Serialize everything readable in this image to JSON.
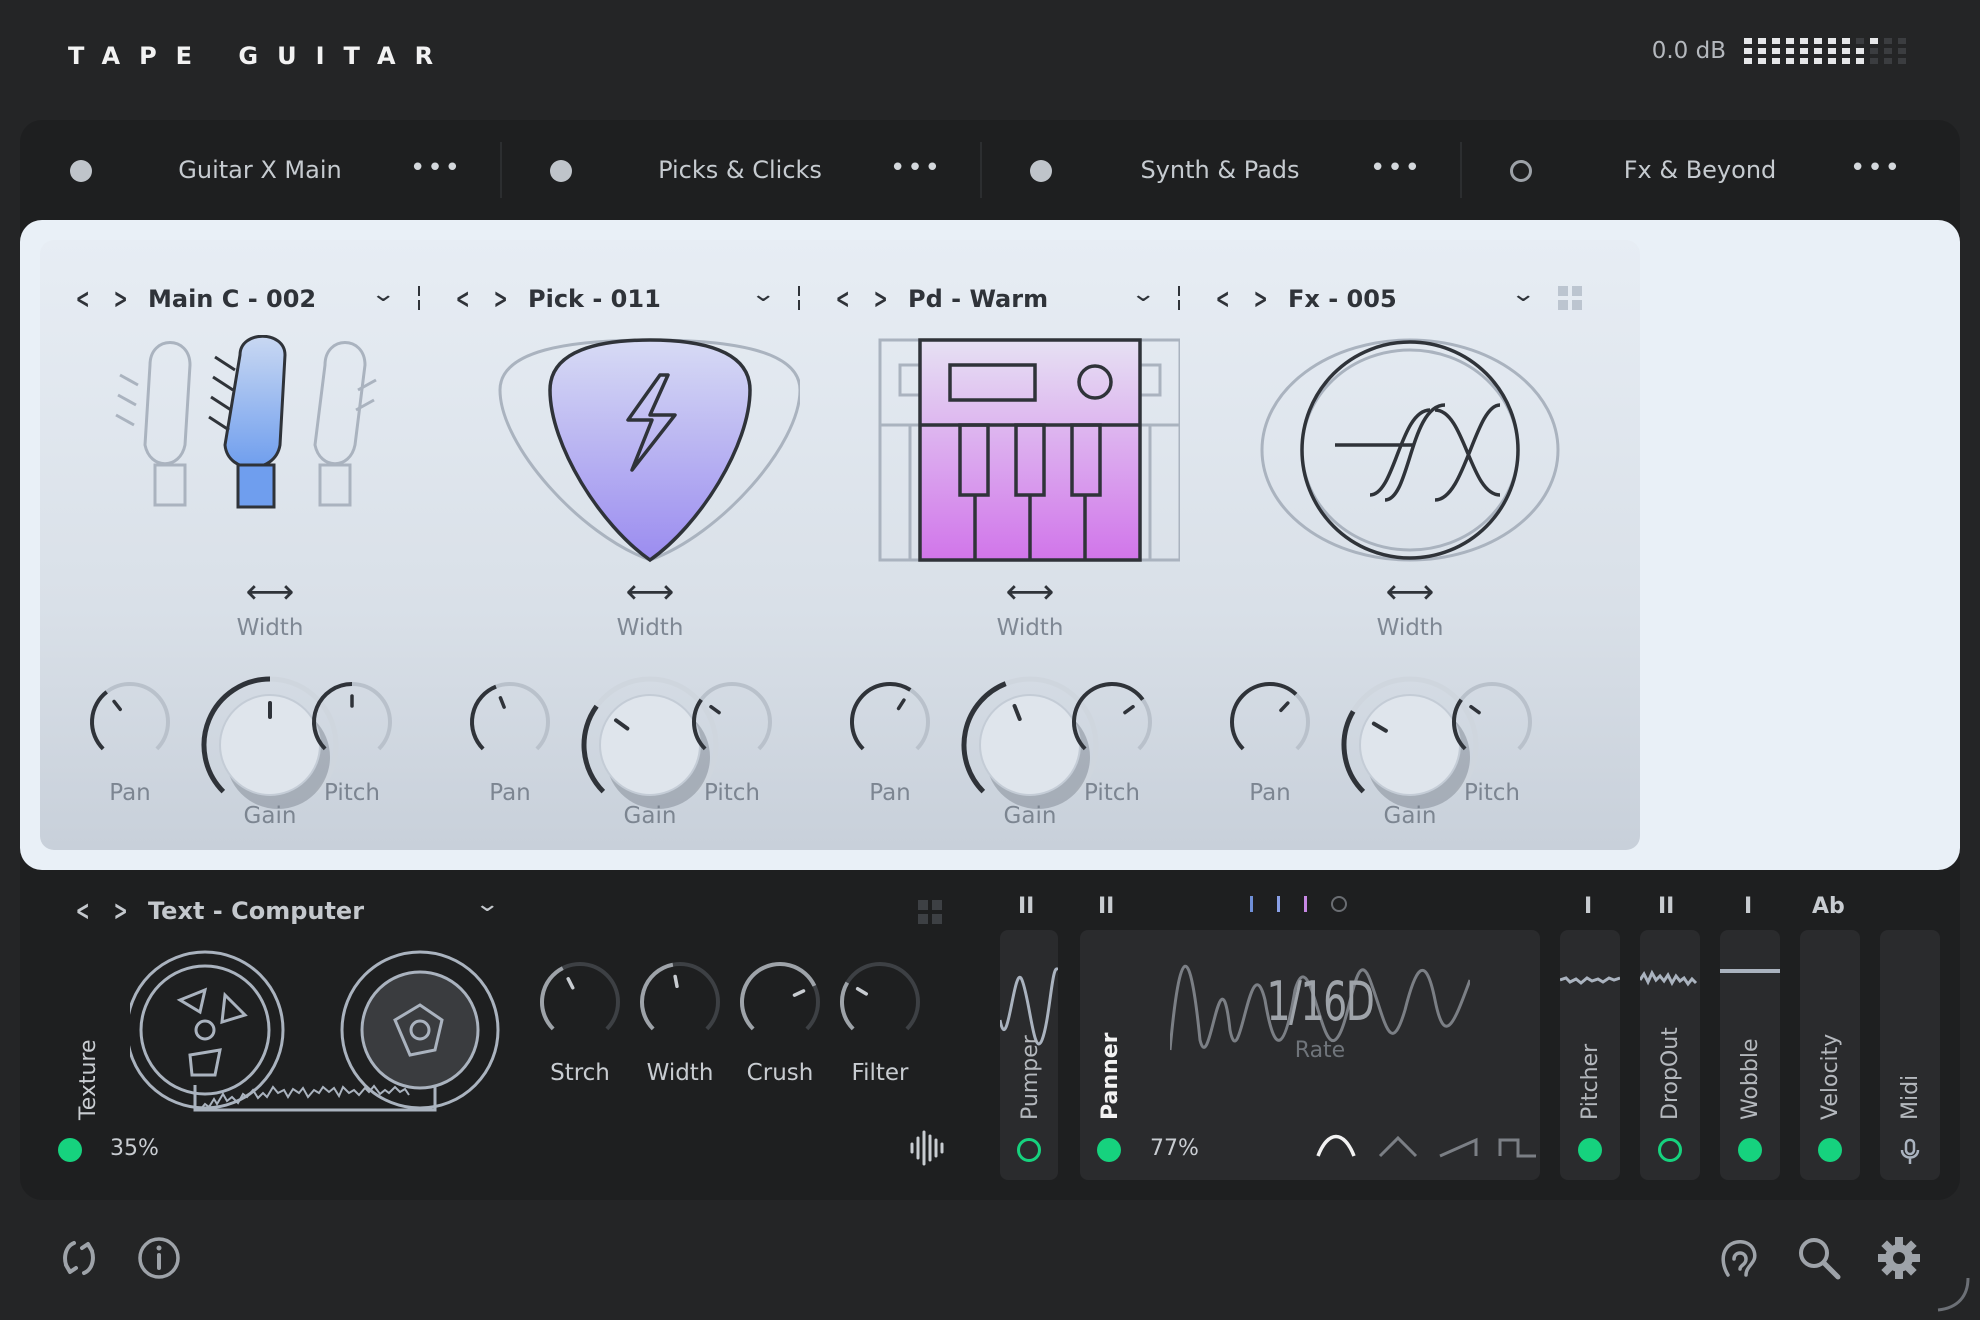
{
  "app": {
    "title": "TAPE GUITAR",
    "output_level": "0.0 dB"
  },
  "slots": [
    {
      "name": "Guitar X Main",
      "enabled": true
    },
    {
      "name": "Picks & Clicks",
      "enabled": true
    },
    {
      "name": "Synth & Pads",
      "enabled": true
    },
    {
      "name": "Fx & Beyond",
      "enabled": false
    }
  ],
  "cards": [
    {
      "preset": "Main C - 002",
      "illustration": "guitar-headstock",
      "width_label": "Width",
      "knobs": {
        "pan_label": "Pan",
        "gain_label": "Gain",
        "pitch_label": "Pitch",
        "pan": 0.36,
        "gain": 0.5,
        "pitch": 0.5
      }
    },
    {
      "preset": "Pick - 011",
      "illustration": "guitar-pick",
      "width_label": "Width",
      "knobs": {
        "pan_label": "Pan",
        "gain_label": "Gain",
        "pitch_label": "Pitch",
        "pan": 0.42,
        "gain": 0.3,
        "pitch": 0.3
      }
    },
    {
      "preset": "Pd - Warm",
      "illustration": "synth-keyboard",
      "width_label": "Width",
      "knobs": {
        "pan_label": "Pan",
        "gain_label": "Gain",
        "pitch_label": "Pitch",
        "pan": 0.62,
        "gain": 0.42,
        "pitch": 0.7
      }
    },
    {
      "preset": "Fx - 005",
      "illustration": "fx-globe",
      "width_label": "Width",
      "knobs": {
        "pan_label": "Pan",
        "gain_label": "Gain",
        "pitch_label": "Pitch",
        "pan": 0.66,
        "gain": 0.28,
        "pitch": 0.3
      }
    }
  ],
  "tape": {
    "preset": "Text - Computer",
    "texture_label": "Texture",
    "texture_value": "35%",
    "knobs": [
      {
        "label": "Strch",
        "value": 0.4
      },
      {
        "label": "Width",
        "value": 0.46
      },
      {
        "label": "Crush",
        "value": 0.74
      },
      {
        "label": "Filter",
        "value": 0.28
      }
    ]
  },
  "modulators": {
    "pumper": {
      "label": "Pumper",
      "tag": "II"
    },
    "panner": {
      "label": "Panner",
      "tag": "II",
      "value": "77%",
      "rate_value": "1/16D",
      "rate_label": "Rate",
      "shapes": [
        "sine",
        "triangle",
        "saw",
        "square"
      ]
    },
    "columns": [
      {
        "label": "Pitcher",
        "tag": "I",
        "active": true
      },
      {
        "label": "DropOut",
        "tag": "II",
        "active": false
      },
      {
        "label": "Wobble",
        "tag": "I",
        "active": true
      },
      {
        "label": "Velocity",
        "tag": "Ab",
        "active": true
      },
      {
        "label": "Midi",
        "tag": "",
        "active": false
      }
    ]
  },
  "colors": {
    "accent_green": "#16d27e",
    "guitar_blue": "#7ea7ee",
    "pick_violet": "#a28ff0",
    "synth_pink": "#d27ee9"
  }
}
